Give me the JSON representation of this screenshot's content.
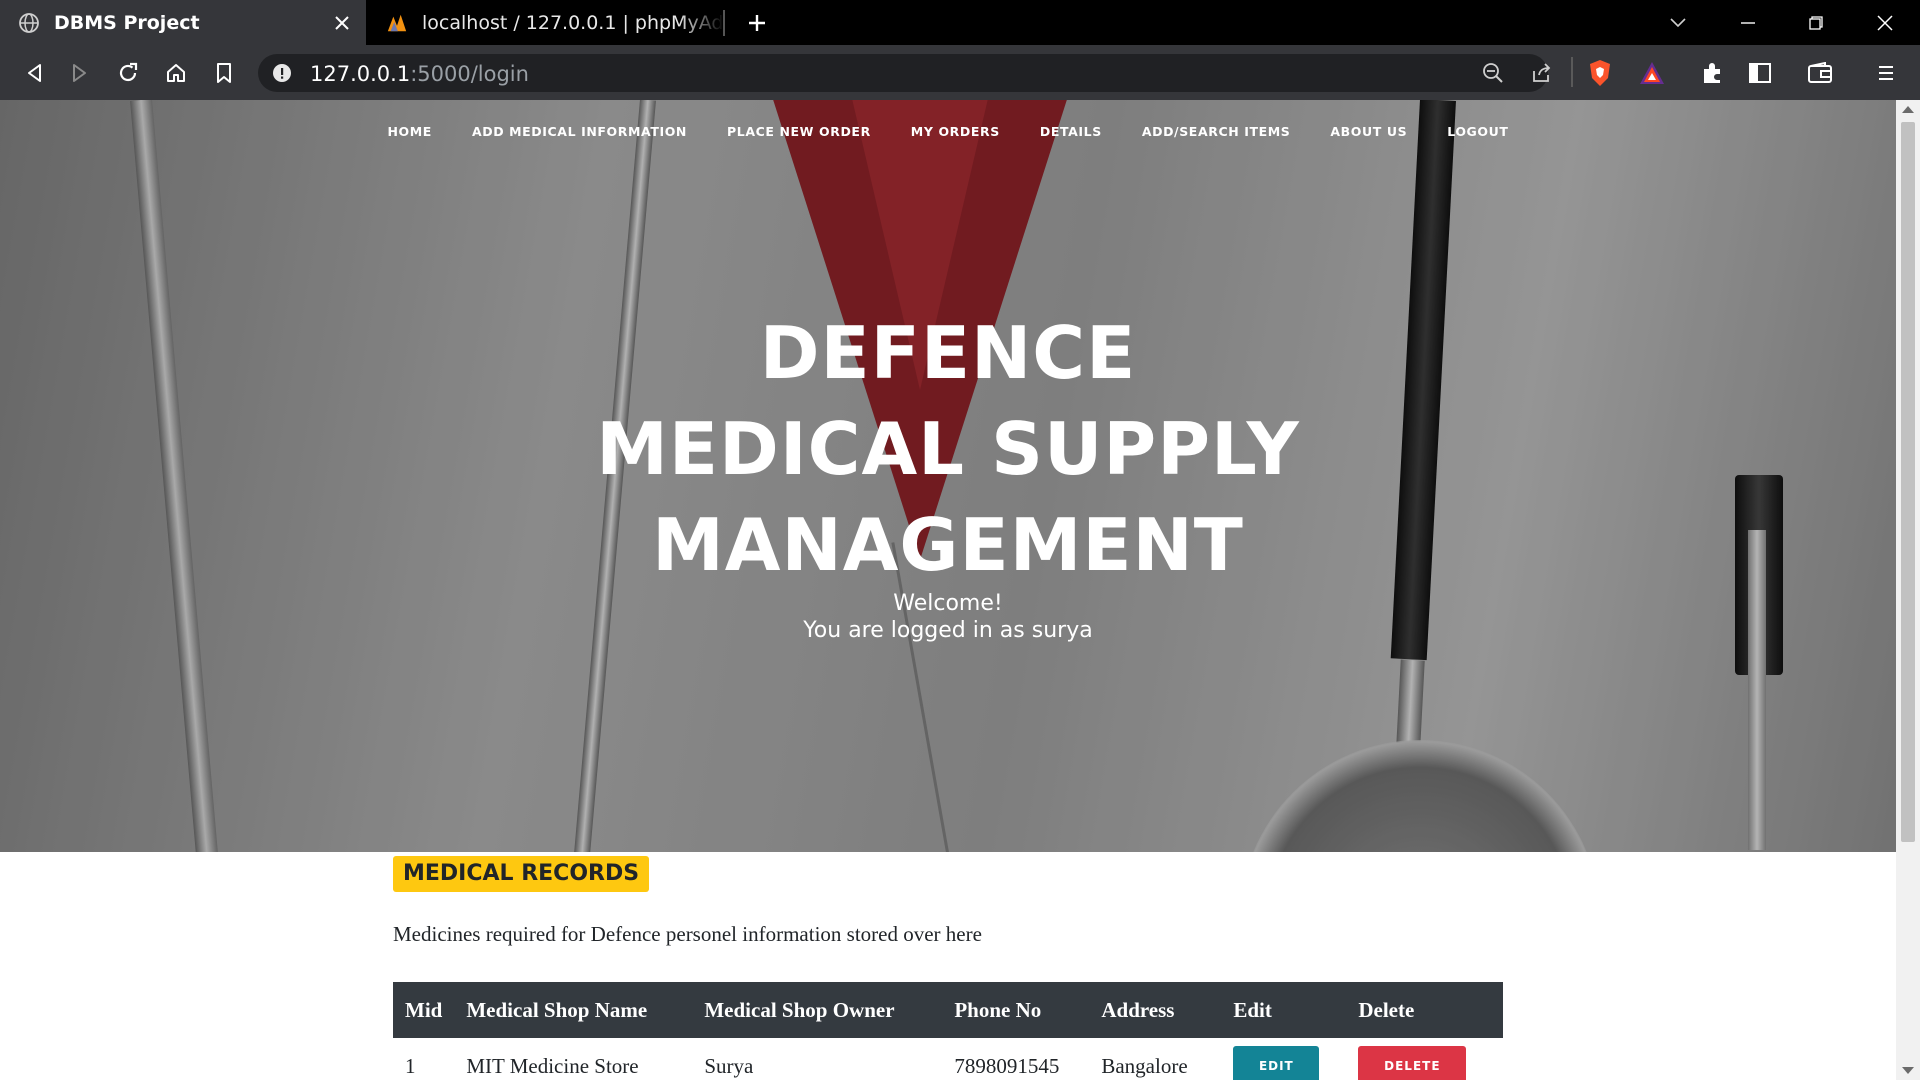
{
  "browser": {
    "tabs": [
      {
        "title": "DBMS Project",
        "active": true
      },
      {
        "title": "localhost / 127.0.0.1 | phpMyAdmin 5.",
        "active": false
      }
    ],
    "url_host": "127.0.0.1",
    "url_path": ":5000/login"
  },
  "nav": {
    "items": [
      "HOME",
      "ADD MEDICAL INFORMATION",
      "PLACE NEW ORDER",
      "MY ORDERS",
      "DETAILS",
      "ADD/SEARCH ITEMS",
      "ABOUT US",
      "LOGOUT"
    ]
  },
  "hero": {
    "title_line1": "DEFENCE",
    "title_line2": "MEDICAL SUPPLY",
    "title_line3": "MANAGEMENT",
    "welcome": "Welcome!",
    "logged_in": "You are logged in as surya"
  },
  "records": {
    "heading": "MEDICAL RECORDS",
    "description": "Medicines required for Defence personel information stored over here",
    "columns": [
      "Mid",
      "Medical Shop Name",
      "Medical Shop Owner",
      "Phone No",
      "Address",
      "Edit",
      "Delete"
    ],
    "rows": [
      {
        "mid": "1",
        "shop_name": "MIT Medicine Store",
        "owner": "Surya",
        "phone": "7898091545",
        "address": "Bangalore",
        "edit_label": "EDIT",
        "delete_label": "DELETE"
      }
    ]
  },
  "colors": {
    "badge": "#fec810",
    "table_header": "#343a40",
    "edit_button": "#138496",
    "delete_button": "#dc3545",
    "tie": "#8a2228"
  }
}
